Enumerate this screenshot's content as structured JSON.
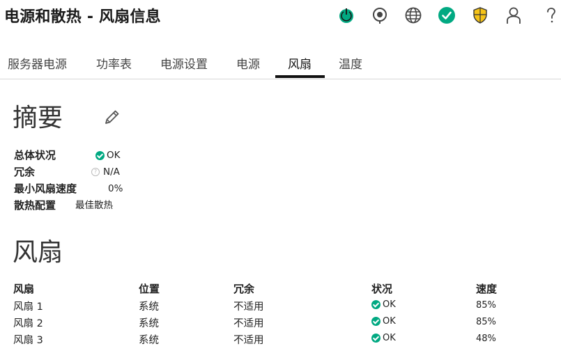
{
  "header": {
    "title": "电源和散热 - 风扇信息"
  },
  "toolbar_icons": [
    {
      "name": "power-icon"
    },
    {
      "name": "location-icon"
    },
    {
      "name": "globe-icon"
    },
    {
      "name": "health-ok-icon"
    },
    {
      "name": "security-shield-icon"
    },
    {
      "name": "user-icon"
    },
    {
      "name": "help-icon"
    }
  ],
  "tabs": [
    {
      "label": "服务器电源"
    },
    {
      "label": "功率表"
    },
    {
      "label": "电源设置"
    },
    {
      "label": "电源"
    },
    {
      "label": "风扇",
      "active": true
    },
    {
      "label": "温度"
    }
  ],
  "summary": {
    "heading": "摘要",
    "rows": [
      {
        "label": "总体状况",
        "value": "OK",
        "status": "ok"
      },
      {
        "label": "冗余",
        "value": "N/A",
        "status": "unknown"
      },
      {
        "label": "最小风扇速度",
        "value": "0%"
      },
      {
        "label": "散热配置",
        "value": "最佳散热"
      }
    ]
  },
  "fans": {
    "heading": "风扇",
    "columns": [
      "风扇",
      "位置",
      "冗余",
      "状况",
      "速度"
    ],
    "rows": [
      {
        "fan": "风扇 1",
        "location": "系统",
        "redundancy": "不适用",
        "status": "OK",
        "speed": "85%"
      },
      {
        "fan": "风扇 2",
        "location": "系统",
        "redundancy": "不适用",
        "status": "OK",
        "speed": "85%"
      },
      {
        "fan": "风扇 3",
        "location": "系统",
        "redundancy": "不适用",
        "status": "OK",
        "speed": "48%"
      }
    ]
  },
  "colors": {
    "ok_green": "#01a982",
    "shield_yellow": "#f5c318",
    "text": "#222222"
  }
}
